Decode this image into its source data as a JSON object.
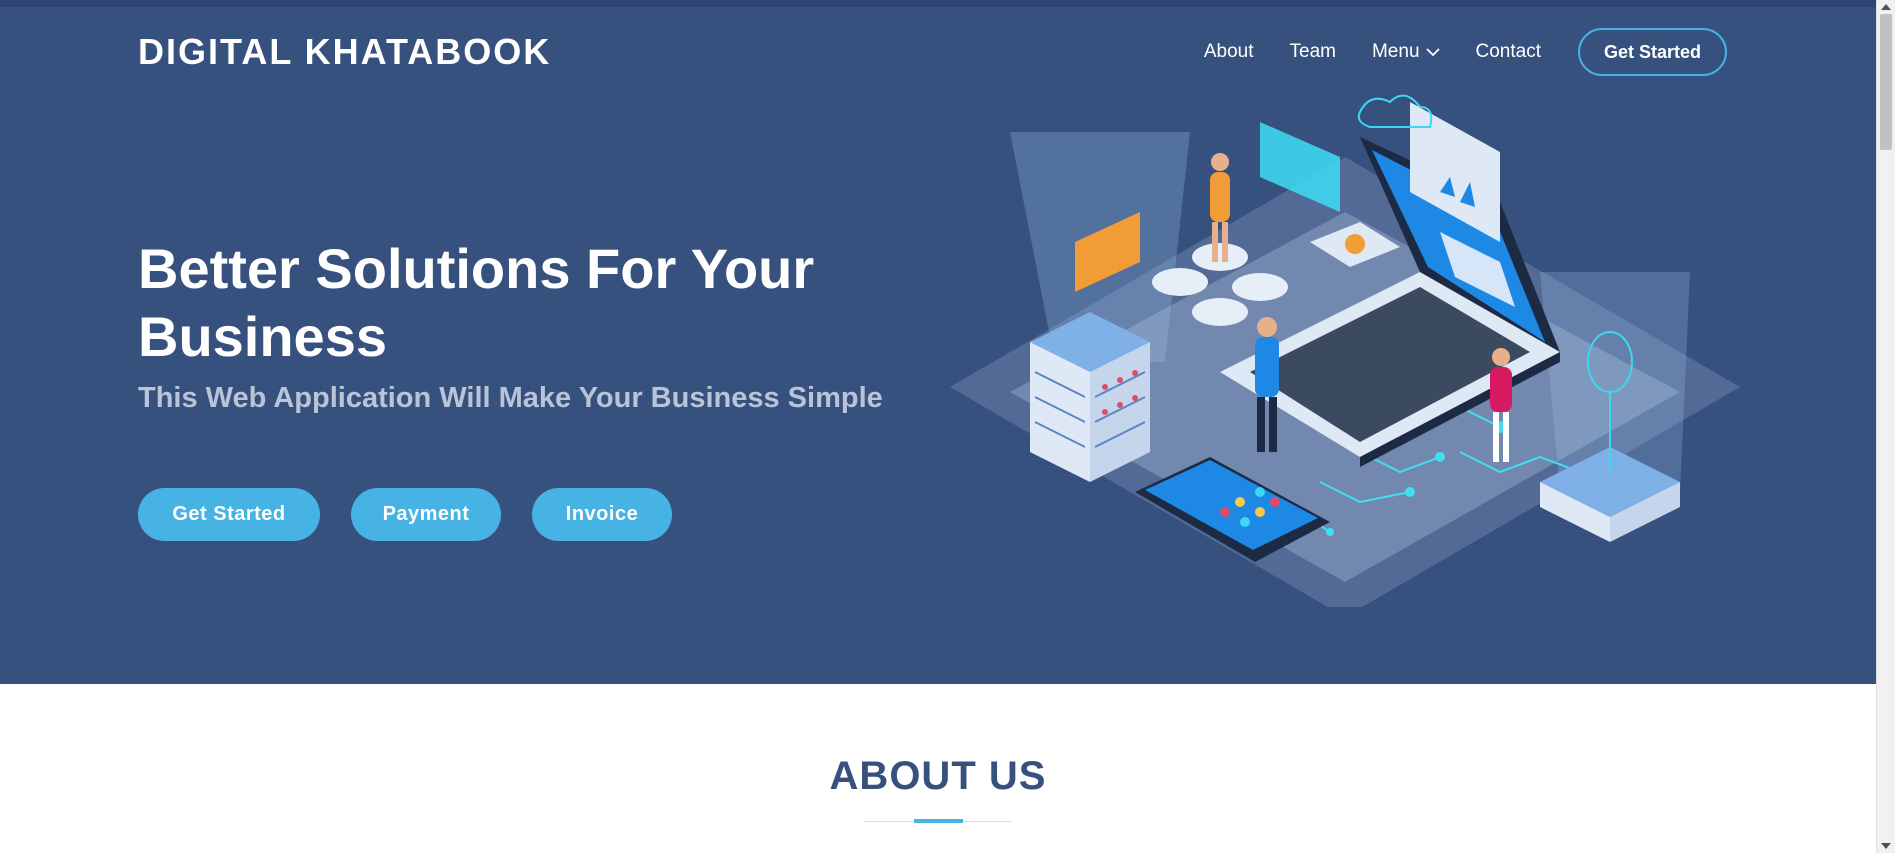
{
  "brand": {
    "name": "DIGITAL KHATABOOK"
  },
  "nav": {
    "items": [
      "About",
      "Team",
      "Menu",
      "Contact"
    ],
    "cta": "Get Started"
  },
  "hero": {
    "title": "Better Solutions For Your Business",
    "subtitle": "This Web Application Will Make Your Business Simple",
    "buttons": [
      "Get Started",
      "Payment",
      "Invoice"
    ]
  },
  "about": {
    "title": "ABOUT US"
  },
  "colors": {
    "hero_bg": "#37517e",
    "accent": "#47b2e4",
    "white": "#ffffff",
    "subtitle": "#b9c4d8"
  },
  "icons": {
    "menu_dropdown": "chevron-down-icon",
    "illustration": "isometric-tech-illustration"
  }
}
